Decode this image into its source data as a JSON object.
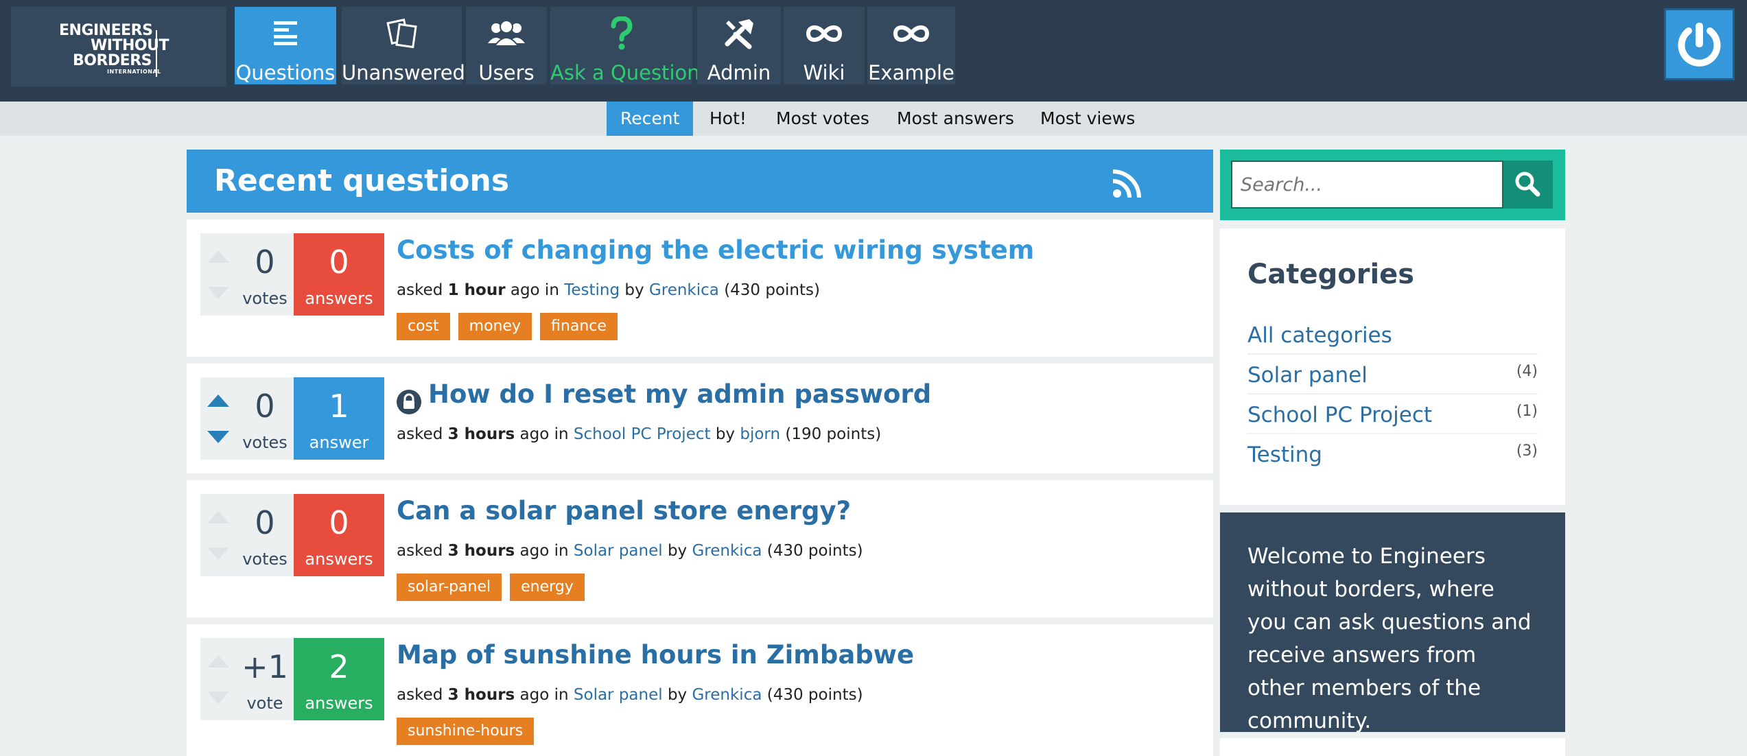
{
  "brand": {
    "logo_lines": [
      "ENGINEERS",
      "WITHOUT",
      "BORDERS",
      "INTERNATIONAL"
    ]
  },
  "nav": {
    "items": [
      {
        "label": "Questions",
        "icon": "questions-icon"
      },
      {
        "label": "Unanswered",
        "icon": "unanswered-icon"
      },
      {
        "label": "Users",
        "icon": "users-icon"
      },
      {
        "label": "Ask a Question",
        "icon": "question-mark-icon"
      },
      {
        "label": "Admin",
        "icon": "admin-tools-icon"
      },
      {
        "label": "Wiki",
        "icon": "infinity-icon"
      },
      {
        "label": "Example",
        "icon": "infinity-icon"
      }
    ],
    "active": "Questions",
    "power_icon": "power-icon"
  },
  "subnav": {
    "items": [
      "Recent",
      "Hot!",
      "Most votes",
      "Most answers",
      "Most views"
    ],
    "active": "Recent"
  },
  "main": {
    "title": "Recent questions",
    "rss_icon": "rss-icon",
    "questions": [
      {
        "votes": "0",
        "votes_label": "votes",
        "answers": "0",
        "answers_label": "answers",
        "title": "Costs of changing the electric wiring system",
        "asked": "asked",
        "when": "1 hour",
        "ago": "ago in",
        "category": "Testing",
        "by": "by",
        "user": "Grenkica",
        "points": "(430 points)",
        "tags": [
          "cost",
          "money",
          "finance"
        ]
      },
      {
        "votes": "0",
        "votes_label": "votes",
        "answers": "1",
        "answers_label": "answer",
        "title": "How do I reset my admin password",
        "asked": "asked",
        "when": "3 hours",
        "ago": "ago in",
        "category": "School PC Project",
        "by": "by",
        "user": "bjorn",
        "points": "(190 points)",
        "tags": []
      },
      {
        "votes": "0",
        "votes_label": "votes",
        "answers": "0",
        "answers_label": "answers",
        "title": "Can a solar panel store energy?",
        "asked": "asked",
        "when": "3 hours",
        "ago": "ago in",
        "category": "Solar panel",
        "by": "by",
        "user": "Grenkica",
        "points": "(430 points)",
        "tags": [
          "solar-panel",
          "energy"
        ]
      },
      {
        "votes": "+1",
        "votes_label": "vote",
        "answers": "2",
        "answers_label": "answers",
        "title": "Map of sunshine hours in Zimbabwe",
        "asked": "asked",
        "when": "3 hours",
        "ago": "ago in",
        "category": "Solar panel",
        "by": "by",
        "user": "Grenkica",
        "points": "(430 points)",
        "tags": [
          "sunshine-hours"
        ]
      }
    ]
  },
  "sidebar": {
    "search_placeholder": "Search...",
    "categories_title": "Categories",
    "categories": [
      {
        "name": "All categories",
        "count": ""
      },
      {
        "name": "Solar panel",
        "count": "(4)"
      },
      {
        "name": "School PC Project",
        "count": "(1)"
      },
      {
        "name": "Testing",
        "count": "(3)"
      }
    ],
    "welcome": "Welcome to Engineers without borders, where you can ask questions and receive answers from other members of the community."
  },
  "colors": {
    "topbar": "#2c3e50",
    "nav_button": "#34495e",
    "accent_blue": "#3498db",
    "ask_green": "#2ecc71",
    "answers_zero": "#e74c3c",
    "answers_accepted": "#27ae60",
    "tag_orange": "#e67e22",
    "search_teal": "#1abc9c"
  }
}
